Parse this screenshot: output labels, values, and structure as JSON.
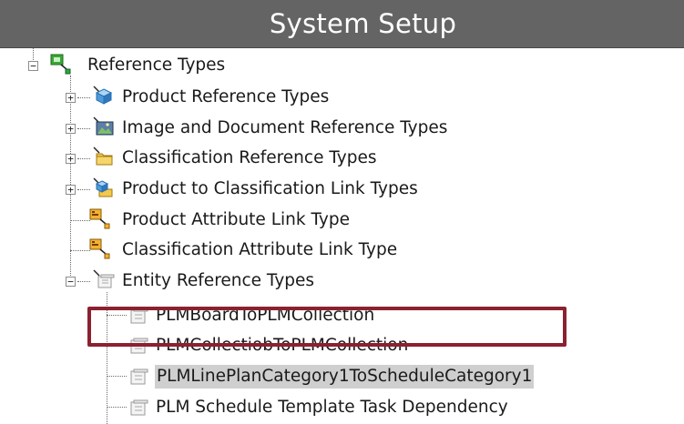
{
  "window": {
    "title": "System Setup"
  },
  "tree": {
    "root": {
      "label": "Reference Types",
      "children": [
        {
          "label": "Product Reference Types",
          "icon": "cube-icon"
        },
        {
          "label": "Image and Document Reference Types",
          "icon": "image-icon"
        },
        {
          "label": "Classification Reference Types",
          "icon": "folder-icon"
        },
        {
          "label": "Product to Classification Link Types",
          "icon": "link-icon"
        },
        {
          "label": "Product Attribute Link Type",
          "icon": "attribute-link-icon"
        },
        {
          "label": "Classification Attribute Link Type",
          "icon": "attribute-link-icon"
        },
        {
          "label": "Entity Reference Types",
          "icon": "entity-reference-icon",
          "children": [
            {
              "label": "PLMBoardToPLMCollection"
            },
            {
              "label": "PLMCollectiobToPLMCollection"
            },
            {
              "label": "PLMLinePlanCategory1ToScheduleCategory1",
              "selected": true
            },
            {
              "label": "PLM Schedule Template Task Dependency"
            }
          ]
        }
      ]
    }
  },
  "colors": {
    "titlebar": "#646464",
    "highlight": "#8b2130",
    "selection": "#cfcfcf"
  }
}
